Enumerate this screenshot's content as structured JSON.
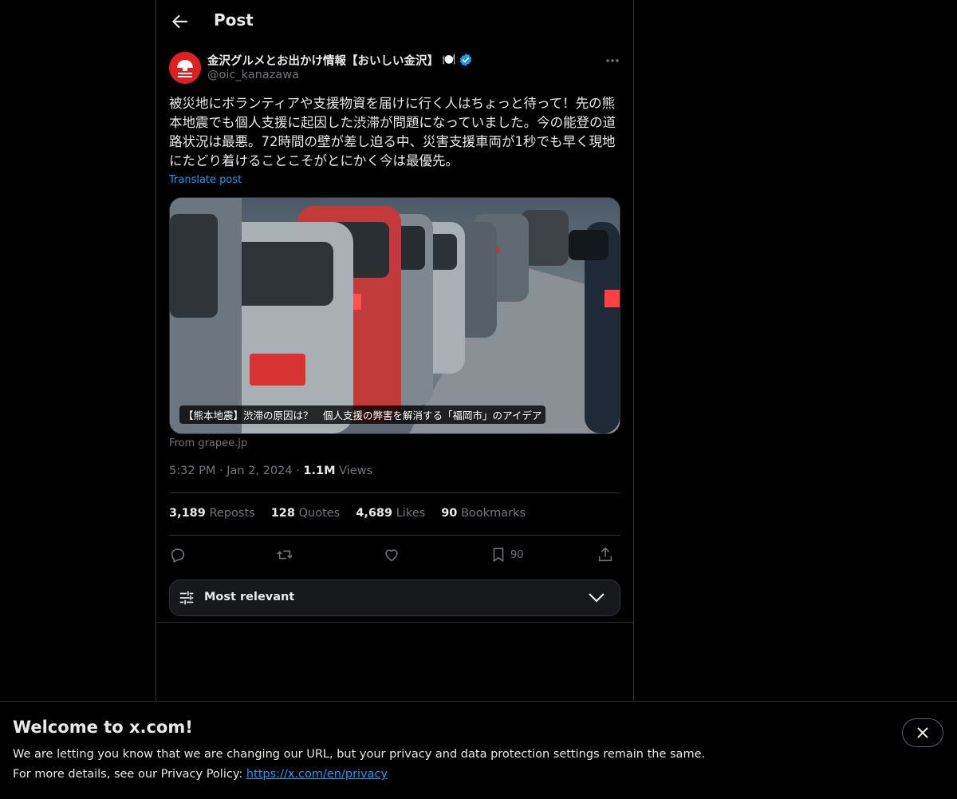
{
  "header": {
    "title": "Post",
    "back_icon": "arrow-left-icon"
  },
  "author": {
    "name": "金沢グルメとお出かけ情報【おいしい金沢】",
    "handle": "@oic_kanazawa",
    "badge_emoji": "🍽️",
    "verified_icon": "verified-badge-icon",
    "avatar_color": "#e02020"
  },
  "post": {
    "text": "被災地にボランティアや支援物資を届けに行く人はちょっと待って！先の熊本地震でも個人支援に起因した渋滞が問題になっていました。今の能登の道路状況は最悪。72時間の壁が差し迫る中、災害支援車両が1秒でも早く現地にたどり着けることこそがとにかく今は最優先。",
    "translate_label": "Translate post",
    "card_caption": "【熊本地震】渋滞の原因は？　個人支援の弊害を解消する「福岡市」のアイデア",
    "card_source": "From grapee.jp",
    "time": "5:32 PM",
    "date": "Jan 2, 2024",
    "views_count": "1.1M",
    "views_label": "Views"
  },
  "stats": [
    {
      "count": "3,189",
      "label": "Reposts"
    },
    {
      "count": "128",
      "label": "Quotes"
    },
    {
      "count": "4,689",
      "label": "Likes"
    },
    {
      "count": "90",
      "label": "Bookmarks"
    }
  ],
  "actions": {
    "bookmark_count": "90"
  },
  "sort": {
    "label": "Most relevant"
  },
  "banner": {
    "title": "Welcome to x.com!",
    "line1": "We are letting you know that we are changing our URL, but your privacy and data protection settings remain the same.",
    "line2_prefix": "For more details, see our Privacy Policy: ",
    "link": "https://x.com/en/privacy"
  },
  "colors": {
    "accent": "#1d9bf0",
    "background": "#000000",
    "text": "#e7e9ea",
    "muted": "#71767b"
  }
}
